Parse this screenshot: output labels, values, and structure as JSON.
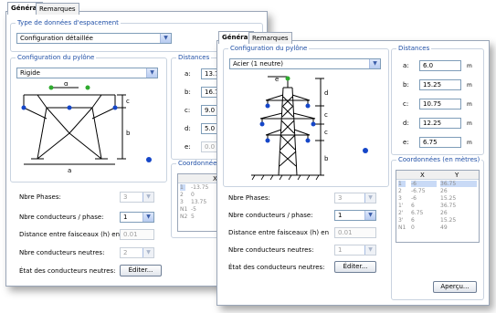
{
  "back": {
    "tabs": {
      "general": "Général",
      "remarques": "Remarques"
    },
    "spacing_group": {
      "title": "Type de données d'espacement",
      "selected": "Configuration détaillée",
      "fragment": "D"
    },
    "pylon_group": {
      "title": "Configuration du pylône",
      "selected": "Rigide"
    },
    "distances_group": {
      "title": "Distances",
      "rows": [
        {
          "label": "a:",
          "value": "13.7"
        },
        {
          "label": "b:",
          "value": "16.7"
        },
        {
          "label": "c:",
          "value": "9.0"
        },
        {
          "label": "d:",
          "value": "5.0"
        },
        {
          "label": "e:",
          "value": "0.0"
        }
      ]
    },
    "coords_group": {
      "title": "Coordonnées (",
      "col_x": "X",
      "rows": [
        {
          "id": "1",
          "x": "-13.75"
        },
        {
          "id": "2",
          "x": "0"
        },
        {
          "id": "3",
          "x": "13.75"
        },
        {
          "id": "N1",
          "x": "-5"
        },
        {
          "id": "N2",
          "x": "5"
        }
      ]
    },
    "fields": {
      "phases_label": "Nbre Phases:",
      "phases_value": "3",
      "conductors_label": "Nbre conducteurs / phase:",
      "conductors_value": "1",
      "distance_label": "Distance entre faisceaux (h) en",
      "distance_value": "0.01",
      "neutral_label": "Nbre conducteurs neutres:",
      "neutral_value": "2",
      "state_label": "État des conducteurs neutres:",
      "edit_button": "Éditer..."
    },
    "diagram_labels": {
      "d": "d",
      "c": "c",
      "b": "b",
      "a": "a"
    }
  },
  "front": {
    "tabs": {
      "general": "Général",
      "remarques": "Remarques"
    },
    "pylon_group": {
      "title": "Configuration du pylône",
      "selected": "Acier (1 neutre)"
    },
    "distances_group": {
      "title": "Distances",
      "rows": [
        {
          "label": "a:",
          "value": "6.0",
          "unit": "m"
        },
        {
          "label": "b:",
          "value": "15.25",
          "unit": "m"
        },
        {
          "label": "c:",
          "value": "10.75",
          "unit": "m"
        },
        {
          "label": "d:",
          "value": "12.25",
          "unit": "m"
        },
        {
          "label": "e:",
          "value": "6.75",
          "unit": "m"
        }
      ]
    },
    "coords_group": {
      "title": "Coordonnées (en mètres)",
      "col_x": "X",
      "col_y": "Y",
      "rows": [
        {
          "id": "1",
          "x": "-6",
          "y": "36.75"
        },
        {
          "id": "2",
          "x": "-6.75",
          "y": "26"
        },
        {
          "id": "3",
          "x": "-6",
          "y": "15.25"
        },
        {
          "id": "1'",
          "x": "6",
          "y": "36.75"
        },
        {
          "id": "2'",
          "x": "6.75",
          "y": "26"
        },
        {
          "id": "3'",
          "x": "6",
          "y": "15.25"
        },
        {
          "id": "N1",
          "x": "0",
          "y": "49"
        }
      ]
    },
    "fields": {
      "phases_label": "Nbre Phases:",
      "phases_value": "3",
      "conductors_label": "Nbre conducteurs / phase:",
      "conductors_value": "1",
      "distance_label": "Distance entre faisceaux (h) en",
      "distance_value": "0.01",
      "neutral_label": "Nbre conducteurs neutres:",
      "neutral_value": "1",
      "state_label": "État des conducteurs neutres:",
      "edit_button": "Éditer..."
    },
    "preview_button": "Aperçu...",
    "diagram_labels": {
      "e": "e",
      "d": "d",
      "c1": "c",
      "c2": "c",
      "b": "b"
    }
  },
  "colors": {
    "group_title": "#1f4fa6",
    "conductor_dot": "#1546c8",
    "ground_wire_dot": "#2eaa2e"
  }
}
